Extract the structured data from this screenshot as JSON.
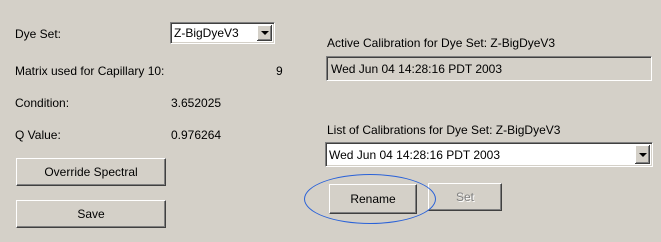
{
  "left": {
    "dye_set_label": "Dye Set:",
    "dye_set_value": "Z-BigDyeV3",
    "matrix_label": "Matrix used for Capillary 10:",
    "matrix_value": "9",
    "condition_label": "Condition:",
    "condition_value": "3.652025",
    "q_value_label": "Q Value:",
    "q_value_value": "0.976264",
    "override_button": "Override Spectral",
    "save_button": "Save"
  },
  "right": {
    "active_calibration_label": "Active Calibration for Dye Set: Z-BigDyeV3",
    "active_calibration_value": "Wed Jun 04 14:28:16 PDT 2003",
    "list_label": "List of Calibrations for Dye Set: Z-BigDyeV3",
    "list_value": "Wed Jun 04 14:28:16 PDT 2003",
    "rename_button": "Rename",
    "set_button": "Set"
  },
  "colors": {
    "background": "#d4d0c8",
    "highlight_ellipse": "#2a62d8"
  },
  "icons": {
    "dropdown": "chevron-down-icon"
  }
}
